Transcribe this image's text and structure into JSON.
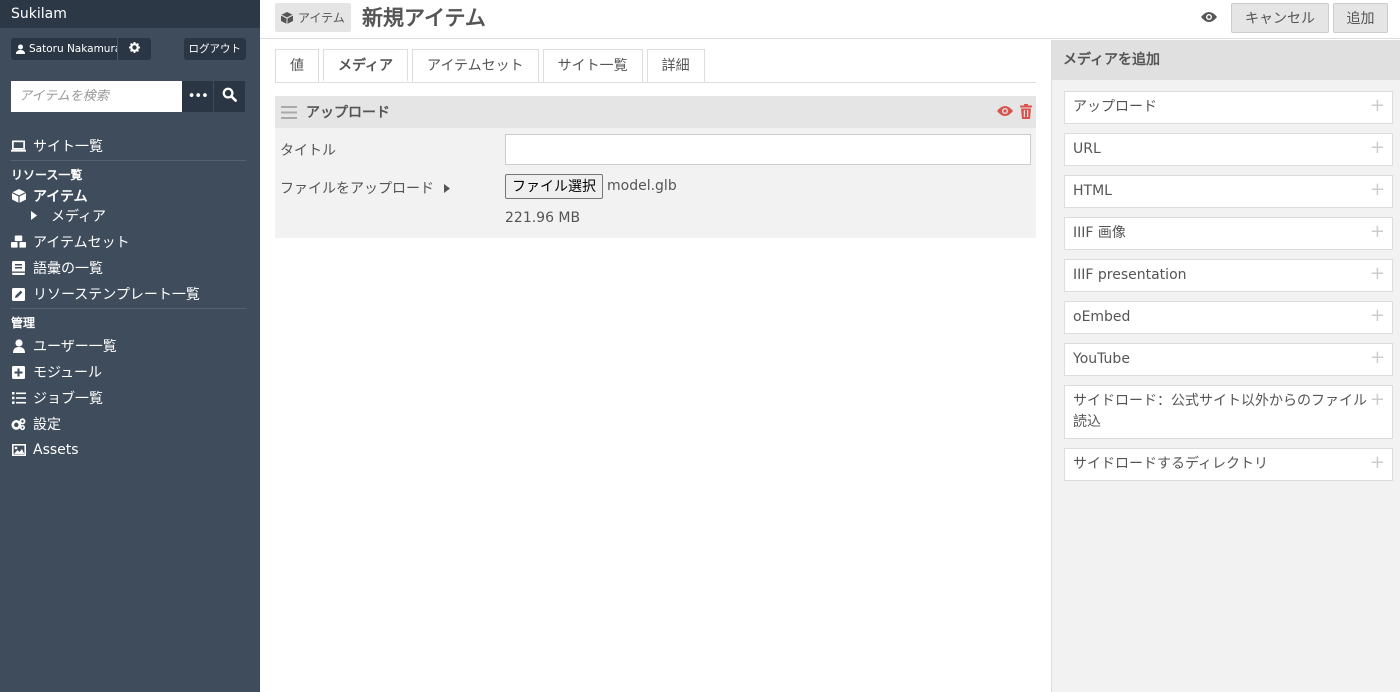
{
  "brand": "Sukilam",
  "user": {
    "name": "Satoru Nakamura",
    "logout_label": "ログアウト"
  },
  "search": {
    "placeholder": "アイテムを検索",
    "more_label": "•••"
  },
  "nav": {
    "sites": "サイト一覧",
    "resources_heading": "リソース一覧",
    "items": "アイテム",
    "media": "メディア",
    "item_sets": "アイテムセット",
    "vocabularies": "語彙の一覧",
    "resource_templates": "リソーステンプレート一覧",
    "admin_heading": "管理",
    "users": "ユーザー一覧",
    "modules": "モジュール",
    "jobs": "ジョブ一覧",
    "settings": "設定",
    "assets": "Assets"
  },
  "header": {
    "crumb": "アイテム",
    "title": "新規アイテム",
    "cancel": "キャンセル",
    "add": "追加"
  },
  "tabs": [
    "値",
    "メディア",
    "アイテムセット",
    "サイト一覧",
    "詳細"
  ],
  "active_tab": "メディア",
  "media": {
    "heading": "アップロード",
    "title_label": "タイトル",
    "title_value": "",
    "upload_label": "ファイルをアップロード",
    "file_button": "ファイル選択",
    "file_name": "model.glb",
    "file_size": "221.96 MB"
  },
  "add_media": {
    "heading": "メディアを追加",
    "options": [
      "アップロード",
      "URL",
      "HTML",
      "IIIF 画像",
      "IIIF presentation",
      "oEmbed",
      "YouTube",
      "サイドロード：公式サイト以外からのファイル読込",
      "サイドロードするディレクトリ"
    ]
  },
  "colors": {
    "sidebar": "#3f4c5c",
    "brand_bar": "#2c3846",
    "danger": "#d9534f"
  },
  "icons": [
    "user-icon",
    "gear-icon",
    "search-icon",
    "laptop-icon",
    "cube-icon",
    "caret-right-icon",
    "cubes-icon",
    "book-icon",
    "edit-icon",
    "plus-square-icon",
    "tasks-icon",
    "cogs-icon",
    "image-icon",
    "eye-icon",
    "drag-handle-icon",
    "trash-icon",
    "plus-icon"
  ]
}
